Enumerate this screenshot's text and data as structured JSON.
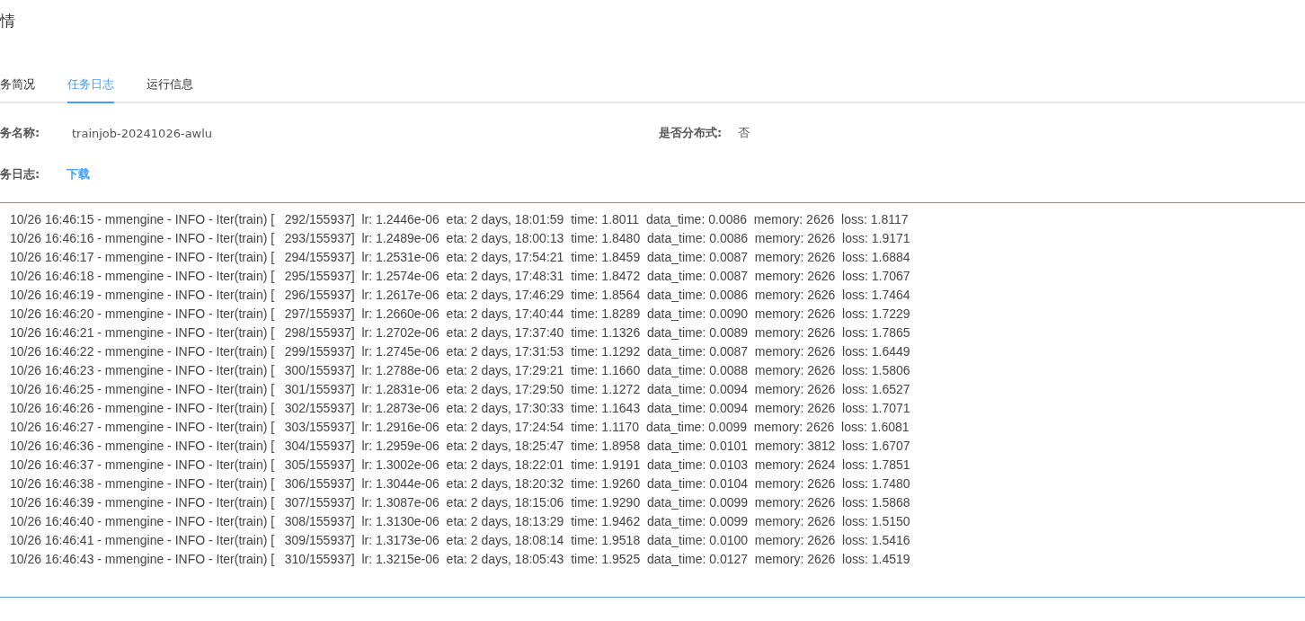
{
  "title": "情",
  "tabs": [
    {
      "label": "务简况",
      "selected": false
    },
    {
      "label": "任务日志",
      "selected": true
    },
    {
      "label": "运行信息",
      "selected": false
    }
  ],
  "fields": [
    {
      "label": "务名称:",
      "value": "trainjob-20241026-awlu"
    },
    {
      "label": "是否分布式:",
      "value": "否"
    }
  ],
  "log_download": {
    "label": "务日志:",
    "link": "下载"
  },
  "log_lines": [
    "10/26 16:46:15 - mmengine - INFO - Iter(train) [   292/155937]  lr: 1.2446e-06  eta: 2 days, 18:01:59  time: 1.8011  data_time: 0.0086  memory: 2626  loss: 1.8117",
    "10/26 16:46:16 - mmengine - INFO - Iter(train) [   293/155937]  lr: 1.2489e-06  eta: 2 days, 18:00:13  time: 1.8480  data_time: 0.0086  memory: 2626  loss: 1.9171",
    "10/26 16:46:17 - mmengine - INFO - Iter(train) [   294/155937]  lr: 1.2531e-06  eta: 2 days, 17:54:21  time: 1.8459  data_time: 0.0087  memory: 2626  loss: 1.6884",
    "10/26 16:46:18 - mmengine - INFO - Iter(train) [   295/155937]  lr: 1.2574e-06  eta: 2 days, 17:48:31  time: 1.8472  data_time: 0.0087  memory: 2626  loss: 1.7067",
    "10/26 16:46:19 - mmengine - INFO - Iter(train) [   296/155937]  lr: 1.2617e-06  eta: 2 days, 17:46:29  time: 1.8564  data_time: 0.0086  memory: 2626  loss: 1.7464",
    "10/26 16:46:20 - mmengine - INFO - Iter(train) [   297/155937]  lr: 1.2660e-06  eta: 2 days, 17:40:44  time: 1.8289  data_time: 0.0090  memory: 2626  loss: 1.7229",
    "10/26 16:46:21 - mmengine - INFO - Iter(train) [   298/155937]  lr: 1.2702e-06  eta: 2 days, 17:37:40  time: 1.1326  data_time: 0.0089  memory: 2626  loss: 1.7865",
    "10/26 16:46:22 - mmengine - INFO - Iter(train) [   299/155937]  lr: 1.2745e-06  eta: 2 days, 17:31:53  time: 1.1292  data_time: 0.0087  memory: 2626  loss: 1.6449",
    "10/26 16:46:23 - mmengine - INFO - Iter(train) [   300/155937]  lr: 1.2788e-06  eta: 2 days, 17:29:21  time: 1.1660  data_time: 0.0088  memory: 2626  loss: 1.5806",
    "10/26 16:46:25 - mmengine - INFO - Iter(train) [   301/155937]  lr: 1.2831e-06  eta: 2 days, 17:29:50  time: 1.1272  data_time: 0.0094  memory: 2626  loss: 1.6527",
    "10/26 16:46:26 - mmengine - INFO - Iter(train) [   302/155937]  lr: 1.2873e-06  eta: 2 days, 17:30:33  time: 1.1643  data_time: 0.0094  memory: 2626  loss: 1.7071",
    "10/26 16:46:27 - mmengine - INFO - Iter(train) [   303/155937]  lr: 1.2916e-06  eta: 2 days, 17:24:54  time: 1.1170  data_time: 0.0099  memory: 2626  loss: 1.6081",
    "10/26 16:46:36 - mmengine - INFO - Iter(train) [   304/155937]  lr: 1.2959e-06  eta: 2 days, 18:25:47  time: 1.8958  data_time: 0.0101  memory: 3812  loss: 1.6707",
    "10/26 16:46:37 - mmengine - INFO - Iter(train) [   305/155937]  lr: 1.3002e-06  eta: 2 days, 18:22:01  time: 1.9191  data_time: 0.0103  memory: 2624  loss: 1.7851",
    "10/26 16:46:38 - mmengine - INFO - Iter(train) [   306/155937]  lr: 1.3044e-06  eta: 2 days, 18:20:32  time: 1.9260  data_time: 0.0104  memory: 2626  loss: 1.7480",
    "10/26 16:46:39 - mmengine - INFO - Iter(train) [   307/155937]  lr: 1.3087e-06  eta: 2 days, 18:15:06  time: 1.9290  data_time: 0.0099  memory: 2626  loss: 1.5868",
    "10/26 16:46:40 - mmengine - INFO - Iter(train) [   308/155937]  lr: 1.3130e-06  eta: 2 days, 18:13:29  time: 1.9462  data_time: 0.0099  memory: 2626  loss: 1.5150",
    "10/26 16:46:41 - mmengine - INFO - Iter(train) [   309/155937]  lr: 1.3173e-06  eta: 2 days, 18:08:14  time: 1.9518  data_time: 0.0100  memory: 2626  loss: 1.5416",
    "10/26 16:46:43 - mmengine - INFO - Iter(train) [   310/155937]  lr: 1.3215e-06  eta: 2 days, 18:05:43  time: 1.9525  data_time: 0.0127  memory: 2626  loss: 1.4519"
  ]
}
